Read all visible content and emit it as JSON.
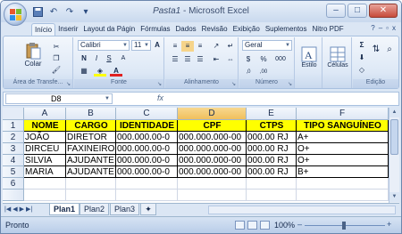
{
  "window": {
    "title_doc": "Pasta1",
    "title_sep": " - ",
    "title_app": "Microsoft Excel",
    "minimize": "–",
    "maximize": "□",
    "close": "✕"
  },
  "ribbon_tabs": [
    "Início",
    "Inserir",
    "Layout da Págin",
    "Fórmulas",
    "Dados",
    "Revisão",
    "Exibição",
    "Suplementos",
    "Nitro PDF"
  ],
  "ribbon": {
    "clipboard": {
      "paste": "Colar",
      "label": "Área de Transfe..."
    },
    "font": {
      "name": "Calibri",
      "size": "11",
      "bold": "N",
      "italic": "I",
      "underline": "S",
      "grow": "A",
      "shrink": "A",
      "label": "Fonte"
    },
    "alignment": {
      "label": "Alinhamento"
    },
    "number": {
      "format": "Geral",
      "currency": "$",
      "percent": "%",
      "thousands": "000",
      "label": "Número"
    },
    "styles": {
      "styles_btn": "Estilo",
      "label": ""
    },
    "cells": {
      "cells_btn": "Células",
      "label": ""
    },
    "editing": {
      "sum": "Σ",
      "label": "Edição"
    }
  },
  "formula_bar": {
    "name_box": "D8",
    "fx": "fx",
    "content": ""
  },
  "columns": [
    "A",
    "B",
    "C",
    "D",
    "E",
    "F"
  ],
  "selected_column": "D",
  "rows": [
    "1",
    "2",
    "3",
    "4",
    "5",
    "6"
  ],
  "table": {
    "headers": [
      "NOME",
      "CARGO",
      "IDENTIDADE",
      "CPF",
      "CTPS",
      "TIPO SANGUÍNEO"
    ],
    "rows": [
      [
        "JOÃO",
        "DIRETOR",
        "000.000.00-0",
        "000.000.000-00",
        "000.00 RJ",
        "A+"
      ],
      [
        "DIRCEU",
        "FAXINEIRO",
        "000.000.00-0",
        "000.000.000-00",
        "000.00 RJ",
        "O+"
      ],
      [
        "SILVIA",
        "AJUDANTE",
        "000.000.00-0",
        "000.000.000-00",
        "000.00 RJ",
        "O+"
      ],
      [
        "MARIA",
        "AJUDANTE",
        "000.000.00-0",
        "000.000.000-00",
        "000.00 RJ",
        "B+"
      ]
    ]
  },
  "sheets": [
    "Plan1",
    "Plan2",
    "Plan3"
  ],
  "active_sheet": "Plan1",
  "status": {
    "mode": "Pronto",
    "zoom": "100%",
    "zoom_minus": "–",
    "zoom_plus": "+"
  },
  "colors": {
    "header_fill": "#ffff00",
    "selected_column": "#f0bf5c",
    "ribbon": "#dde8f6"
  }
}
